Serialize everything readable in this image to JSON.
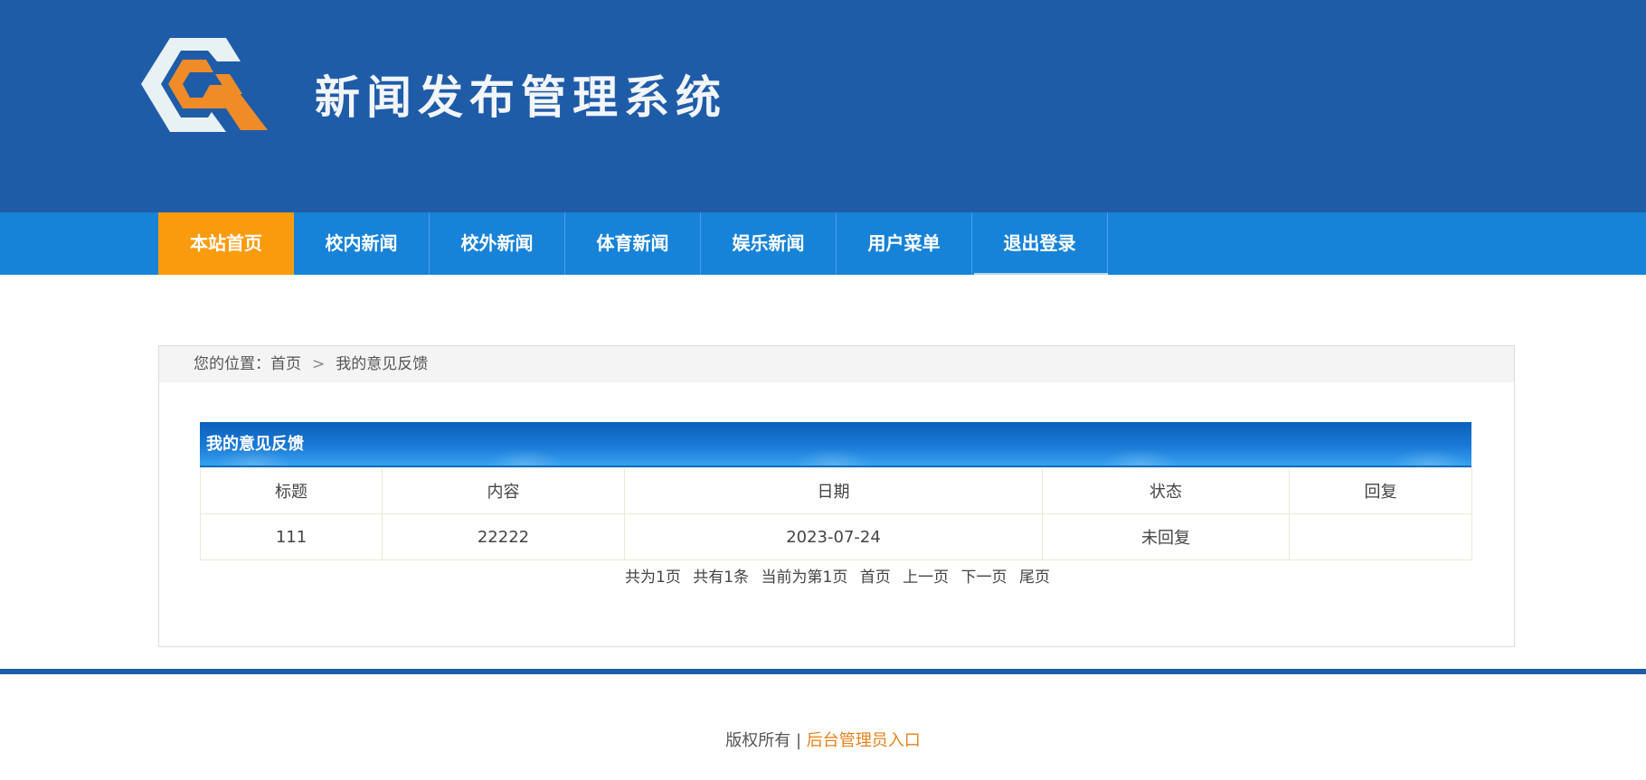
{
  "header": {
    "site_title": "新闻发布管理系统",
    "logo_icon": "hexagon-g-logo",
    "bg_color": "#1f5ca8"
  },
  "nav": {
    "active_color": "#fa9b0e",
    "bg_color": "#1783d8",
    "items": [
      {
        "label": "本站首页"
      },
      {
        "label": "校内新闻"
      },
      {
        "label": "校外新闻"
      },
      {
        "label": "体育新闻"
      },
      {
        "label": "娱乐新闻"
      },
      {
        "label": "用户菜单"
      },
      {
        "label": "退出登录"
      }
    ]
  },
  "breadcrumb": {
    "prefix": "您的位置：",
    "home": "首页",
    "separator": ">",
    "current": "我的意见反馈"
  },
  "panel": {
    "title": "我的意见反馈",
    "columns": [
      "标题",
      "内容",
      "日期",
      "状态",
      "回复"
    ],
    "rows": [
      [
        "111",
        "22222",
        "2023-07-24",
        "未回复",
        ""
      ]
    ]
  },
  "pager": {
    "total_pages": "共为1页",
    "total_items": "共有1条",
    "current_page": "当前为第1页",
    "first": "首页",
    "prev": "上一页",
    "next": "下一页",
    "last": "尾页"
  },
  "footer": {
    "copyright": "版权所有 | ",
    "admin_link": "后台管理员入口",
    "admin_link_color": "#e6801a"
  }
}
